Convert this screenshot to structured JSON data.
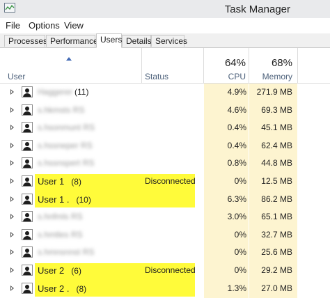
{
  "window": {
    "title": "Task Manager"
  },
  "menu": [
    "File",
    "Options",
    "View"
  ],
  "tabs": [
    "Processes",
    "Performance",
    "Users",
    "Details",
    "Services"
  ],
  "active_tab": "Users",
  "columns": {
    "user": "User",
    "status": "Status",
    "cpu_total": "64%",
    "cpu": "CPU",
    "memory_total": "68%",
    "memory": "Memory"
  },
  "rows": [
    {
      "name": "Haggerer",
      "blurred": true,
      "count": "(11)",
      "status": "",
      "cpu": "4.9%",
      "memory": "271.9 MB"
    },
    {
      "name": "s.hkmsts RS",
      "blurred": true,
      "count": "",
      "status": "",
      "cpu": "4.6%",
      "memory": "69.3 MB"
    },
    {
      "name": "s.hsonmunt RS",
      "blurred": true,
      "count": "",
      "status": "",
      "cpu": "0.4%",
      "memory": "45.1 MB"
    },
    {
      "name": "s.hssneper RS",
      "blurred": true,
      "count": "",
      "status": "",
      "cpu": "0.4%",
      "memory": "62.4 MB"
    },
    {
      "name": "s.hssnspert RS",
      "blurred": true,
      "count": "",
      "status": "",
      "cpu": "0.8%",
      "memory": "44.8 MB"
    },
    {
      "name": "User 1",
      "blurred": false,
      "count": "(8)",
      "status": "Disconnected",
      "cpu": "0%",
      "memory": "12.5 MB",
      "highlight": true
    },
    {
      "name": "User 1 .",
      "blurred": false,
      "count": "(10)",
      "status": "",
      "cpu": "6.3%",
      "memory": "86.2 MB",
      "highlight": true
    },
    {
      "name": "s.hnfmls RS",
      "blurred": true,
      "count": "",
      "status": "",
      "cpu": "3.0%",
      "memory": "65.1 MB"
    },
    {
      "name": "s.hmtles RS",
      "blurred": true,
      "count": "",
      "status": "",
      "cpu": "0%",
      "memory": "32.7 MB"
    },
    {
      "name": "s.hmnsnnst RS",
      "blurred": true,
      "count": "",
      "status": "",
      "cpu": "0%",
      "memory": "25.6 MB"
    },
    {
      "name": "User 2",
      "blurred": false,
      "count": "(6)",
      "status": "Disconnected",
      "cpu": "0%",
      "memory": "29.2 MB",
      "highlight": true
    },
    {
      "name": "User 2 .",
      "blurred": false,
      "count": "(8)",
      "status": "",
      "cpu": "1.3%",
      "memory": "27.0 MB",
      "highlight": true
    }
  ],
  "colors": {
    "highlight": "#fffb3a",
    "column_shade": "#fdf4d0",
    "header_text": "#4c607a"
  }
}
